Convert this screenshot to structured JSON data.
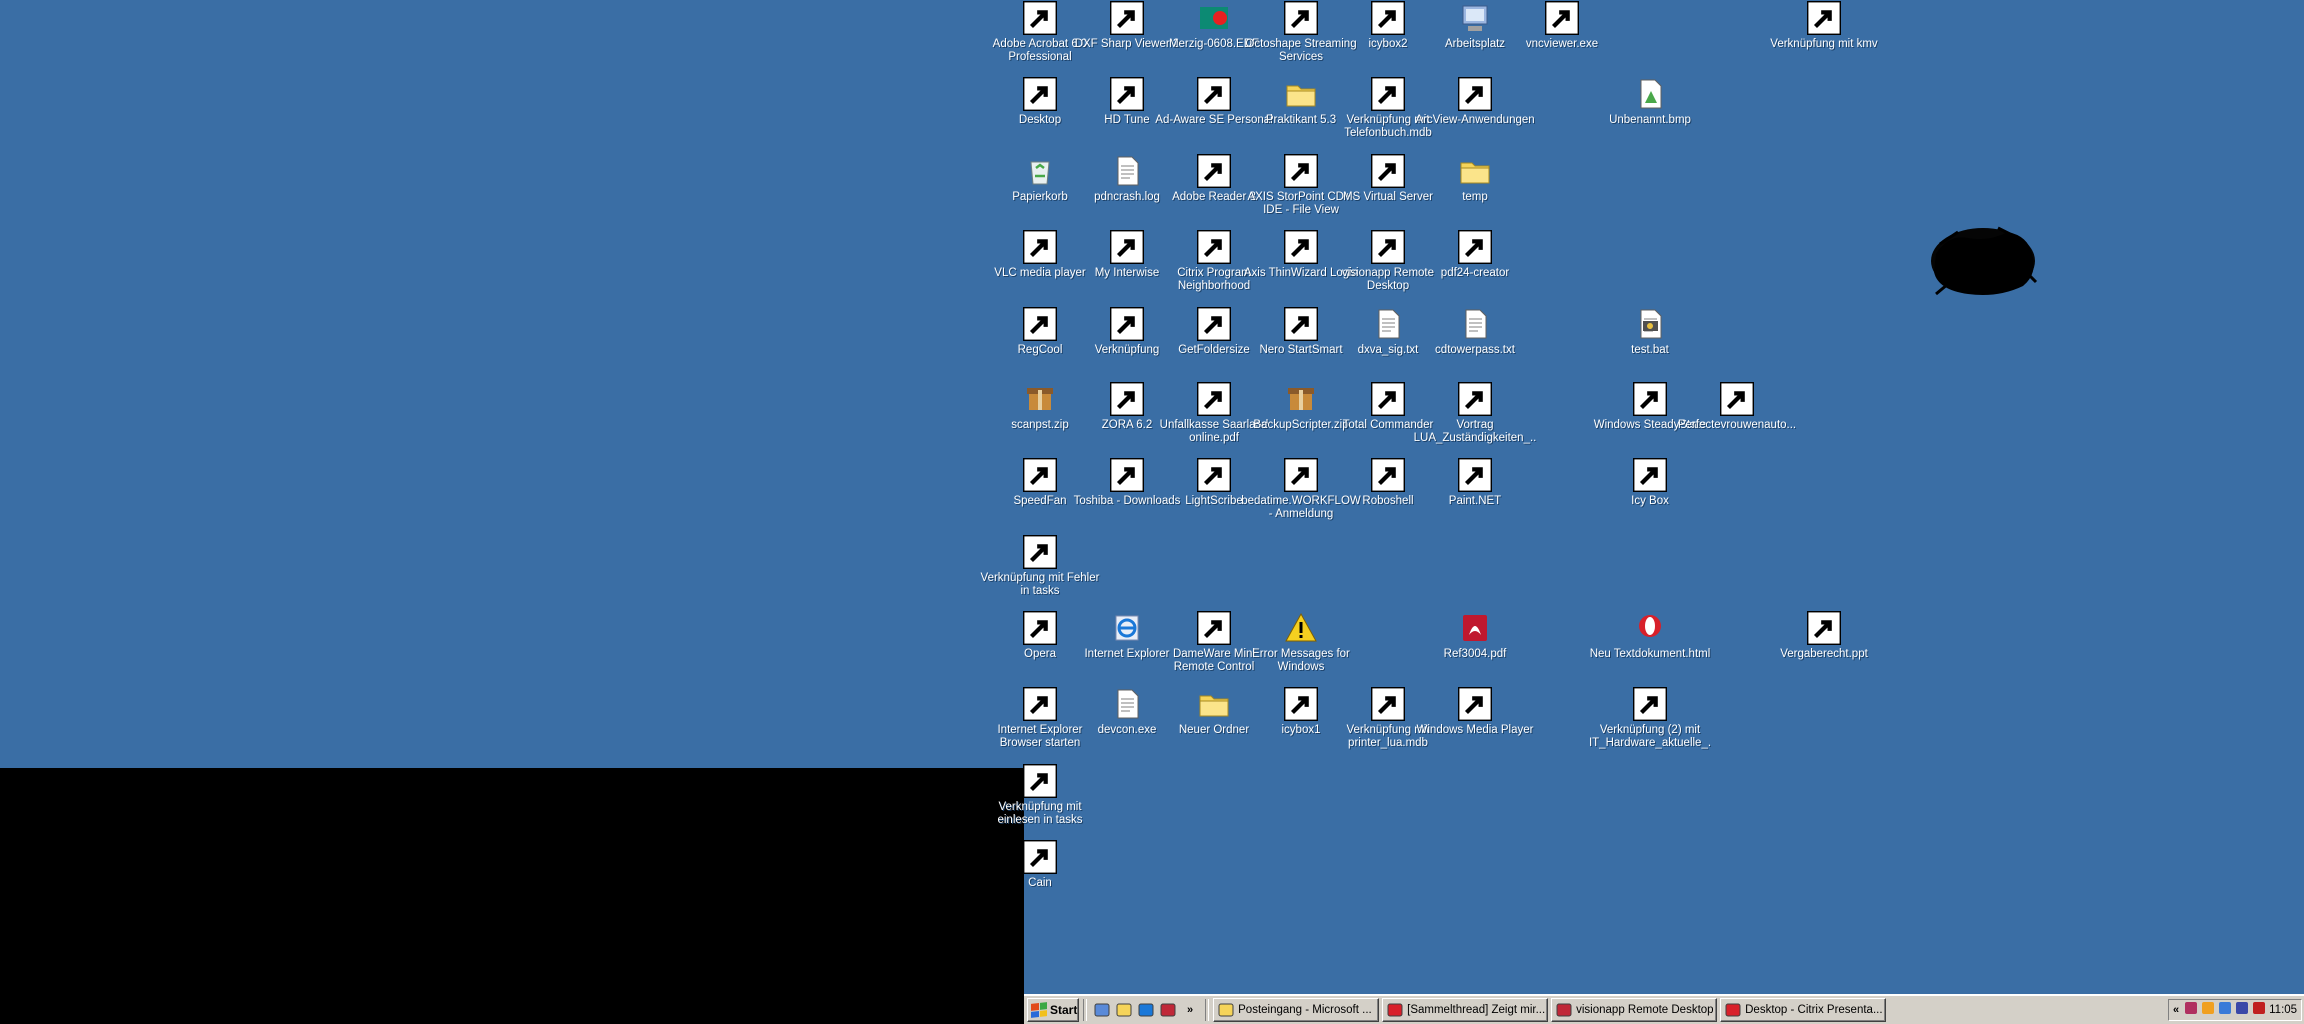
{
  "desktop": {
    "background_color": "#3a6ea5",
    "icons": [
      {
        "label": "Adobe Acrobat 6.0 Professional",
        "icon": "acrobat-icon",
        "color": "#c0182e",
        "shortcut": true
      },
      {
        "label": "DXF Sharp Viewer 2",
        "icon": "dxf-viewer-icon",
        "color": "#2a9d3a",
        "shortcut": true
      },
      {
        "label": "Merzig-0608.EDF",
        "icon": "edf-file-icon",
        "color": "#0c8a73",
        "shortcut": false
      },
      {
        "label": "Octoshape Streaming Services",
        "icon": "octoshape-icon",
        "color": "#c8c8c8",
        "shortcut": true
      },
      {
        "label": "icybox2",
        "icon": "network-drive-icon",
        "color": "#9bb6e0",
        "shortcut": true
      },
      {
        "label": "Arbeitsplatz",
        "icon": "my-computer-icon",
        "color": "#9bb6e0",
        "shortcut": false
      },
      {
        "label": "vncviewer.exe",
        "icon": "vnc-icon",
        "color": "#c0182e",
        "shortcut": true
      },
      {
        "label": "Verknüpfung mit kmv",
        "icon": "folder-shortcut-icon",
        "color": "#f5d45a",
        "shortcut": true
      },
      {
        "label": "Desktop",
        "icon": "desktop-icon",
        "color": "#3aa5d8",
        "shortcut": true
      },
      {
        "label": "HD Tune",
        "icon": "hd-tune-icon",
        "color": "#8a8a8a",
        "shortcut": true
      },
      {
        "label": "Ad-Aware SE Personal",
        "icon": "ad-aware-icon",
        "color": "#d8322a",
        "shortcut": true
      },
      {
        "label": "Praktikant 5.3",
        "icon": "folder-icon",
        "color": "#f5d45a",
        "shortcut": false
      },
      {
        "label": "Verknüpfung mit Telefonbuch.mdb",
        "icon": "mdb-shortcut-icon",
        "color": "#b04050",
        "shortcut": true
      },
      {
        "label": "ArcView-Anwendungen",
        "icon": "folder-icon",
        "color": "#f5d45a",
        "shortcut": true
      },
      {
        "label": "Unbenannt.bmp",
        "icon": "bitmap-icon",
        "color": "#4aa84a",
        "shortcut": false
      },
      {
        "label": "Papierkorb",
        "icon": "recycle-bin-icon",
        "color": "#48a848",
        "shortcut": false
      },
      {
        "label": "pdncrash.log",
        "icon": "text-file-icon",
        "color": "#ffffff",
        "shortcut": false
      },
      {
        "label": "Adobe Reader 8",
        "icon": "adobe-reader-icon",
        "color": "#c0182e",
        "shortcut": true
      },
      {
        "label": "AXIS StorPoint CD+-IDE - File View",
        "icon": "web-shortcut-icon",
        "color": "#3a7ad8",
        "shortcut": true
      },
      {
        "label": "MS Virtual Server",
        "icon": "web-shortcut-icon",
        "color": "#3a7ad8",
        "shortcut": true
      },
      {
        "label": "temp",
        "icon": "folder-icon",
        "color": "#f5d45a",
        "shortcut": false
      },
      {
        "label": "VLC media player",
        "icon": "vlc-icon",
        "color": "#f08a1a",
        "shortcut": true
      },
      {
        "label": "My Interwise",
        "icon": "info-icon",
        "color": "#e8a020",
        "shortcut": true
      },
      {
        "label": "Citrix Program Neighborhood",
        "icon": "citrix-icon",
        "color": "#d8202a",
        "shortcut": true
      },
      {
        "label": "Axis ThinWizard Login",
        "icon": "warning-shortcut-icon",
        "color": "#f5d020",
        "shortcut": true
      },
      {
        "label": "visionapp Remote Desktop",
        "icon": "rss-remote-icon",
        "color": "#c02838",
        "shortcut": true
      },
      {
        "label": "pdf24-creator",
        "icon": "pdf24-icon",
        "color": "#e8e8e8",
        "shortcut": true
      },
      {
        "label": "RegCool",
        "icon": "regcool-icon",
        "color": "#5a8ad8",
        "shortcut": true
      },
      {
        "label": "Verknüpfung",
        "icon": "folder-shortcut-icon",
        "color": "#f5d45a",
        "shortcut": true,
        "redacted": true
      },
      {
        "label": "GetFoldersize",
        "icon": "getfoldersize-icon",
        "color": "#f5d45a",
        "shortcut": true
      },
      {
        "label": "Nero StartSmart",
        "icon": "nero-icon",
        "color": "#e84020",
        "shortcut": true
      },
      {
        "label": "dxva_sig.txt",
        "icon": "text-file-icon",
        "color": "#ffffff",
        "shortcut": false
      },
      {
        "label": "cdtowerpass.txt",
        "icon": "text-file-icon",
        "color": "#ffffff",
        "shortcut": false
      },
      {
        "label": "test.bat",
        "icon": "batch-file-icon",
        "color": "#d0d0d0",
        "shortcut": false
      },
      {
        "label": "scanpst.zip",
        "icon": "zip-icon",
        "color": "#c88a3a",
        "shortcut": false
      },
      {
        "label": "ZORA 6.2",
        "icon": "zora-icon",
        "color": "#38a838",
        "shortcut": true
      },
      {
        "label": "Unfallkasse Saarland online.pdf",
        "icon": "pdf-shortcut-icon",
        "color": "#c0182e",
        "shortcut": true
      },
      {
        "label": "BackupScripter.zip",
        "icon": "zip-icon",
        "color": "#c88a3a",
        "shortcut": false
      },
      {
        "label": "Total Commander",
        "icon": "total-commander-icon",
        "color": "#3a48c8",
        "shortcut": true
      },
      {
        "label": "Vortrag LUA_Zuständigkeiten_...",
        "icon": "ppt-shortcut-icon",
        "color": "#e0e0e0",
        "shortcut": true
      },
      {
        "label": "Windows SteadyState",
        "icon": "steadystate-icon",
        "color": "#8ab0e0",
        "shortcut": true
      },
      {
        "label": "Perfectevrouwenauto...",
        "icon": "media-shortcut-icon",
        "color": "#f0f0f0",
        "shortcut": true
      },
      {
        "label": "SpeedFan",
        "icon": "speedfan-icon",
        "color": "#1a1a1a",
        "shortcut": true
      },
      {
        "label": "Toshiba - Downloads",
        "icon": "web-shortcut-icon",
        "color": "#3a7ad8",
        "shortcut": true
      },
      {
        "label": "LightScribe",
        "icon": "lightscribe-icon",
        "color": "#202020",
        "shortcut": true
      },
      {
        "label": "bedatime.WORKFLOW - Anmeldung",
        "icon": "web-shortcut-icon",
        "color": "#3a7ad8",
        "shortcut": true
      },
      {
        "label": "Roboshell",
        "icon": "roboshell-icon",
        "color": "#2a2a7a",
        "shortcut": true
      },
      {
        "label": "Paint.NET",
        "icon": "paintnet-icon",
        "color": "#e8e8f0",
        "shortcut": true
      },
      {
        "label": "Icy Box",
        "icon": "icybox-icon",
        "color": "#2a3aa8",
        "shortcut": true
      },
      {
        "label": "Verknüpfung mit Fehler in tasks",
        "icon": "tasks-shortcut-icon",
        "color": "#e0e0e0",
        "shortcut": true
      },
      {
        "label": "Opera",
        "icon": "opera-icon",
        "color": "#d8202a",
        "shortcut": true
      },
      {
        "label": "Internet Explorer",
        "icon": "ie-icon",
        "color": "#1a78d8",
        "shortcut": false
      },
      {
        "label": "DameWare Mini Remote Control",
        "icon": "dameware-icon",
        "color": "#38a838",
        "shortcut": true
      },
      {
        "label": "Error Messages for Windows",
        "icon": "warning-icon",
        "color": "#f5d020",
        "shortcut": false
      },
      {
        "label": "Ref3004.pdf",
        "icon": "pdf-icon",
        "color": "#c0182e",
        "shortcut": false
      },
      {
        "label": "Neu Textdokument.html",
        "icon": "opera-doc-icon",
        "color": "#d8202a",
        "shortcut": false
      },
      {
        "label": "Vergaberecht.ppt",
        "icon": "ppt-shortcut-icon",
        "color": "#d84a2a",
        "shortcut": true
      },
      {
        "label": "Internet Explorer Browser starten",
        "icon": "ie-icon",
        "color": "#1a78d8",
        "shortcut": true
      },
      {
        "label": "devcon.exe",
        "icon": "exe-icon",
        "color": "#e8e8e8",
        "shortcut": false
      },
      {
        "label": "Neuer Ordner",
        "icon": "folder-icon",
        "color": "#f5d45a",
        "shortcut": false
      },
      {
        "label": "icybox1",
        "icon": "network-drive-icon",
        "color": "#9bb6e0",
        "shortcut": true
      },
      {
        "label": "Verknüpfung mit printer_lua.mdb",
        "icon": "mdb-shortcut-icon",
        "color": "#b04050",
        "shortcut": true
      },
      {
        "label": "Windows Media Player",
        "icon": "wmp-icon",
        "color": "#f0a020",
        "shortcut": true
      },
      {
        "label": "Verknüpfung (2) mit IT_Hardware_aktuelle_...",
        "icon": "mdb-shortcut-icon",
        "color": "#b04050",
        "shortcut": true
      },
      {
        "label": "Verknüpfung mit einlesen in tasks",
        "icon": "script-shortcut-icon",
        "color": "#e8c040",
        "shortcut": true
      },
      {
        "label": "Cain",
        "icon": "cain-icon",
        "color": "#c02020",
        "shortcut": true
      }
    ]
  },
  "taskbar": {
    "start_label": "Start",
    "quick_launch": [
      {
        "icon": "show-desktop-icon",
        "color": "#5a8ad8"
      },
      {
        "icon": "folder-icon",
        "color": "#f5d45a"
      },
      {
        "icon": "ie-icon",
        "color": "#1a78d8"
      },
      {
        "icon": "rss-remote-icon",
        "color": "#c02838"
      }
    ],
    "chevron": "»",
    "tasks": [
      {
        "label": "Posteingang - Microsoft ...",
        "icon": "outlook-icon",
        "color": "#f5d45a"
      },
      {
        "label": "[Sammelthread] Zeigt mir...",
        "icon": "opera-icon",
        "color": "#d8202a"
      },
      {
        "label": "visionapp Remote Desktop",
        "icon": "rss-remote-icon",
        "color": "#c02838"
      },
      {
        "label": "Desktop - Citrix Presenta...",
        "icon": "citrix-icon",
        "color": "#d8202a"
      }
    ],
    "tray_chevron": "«",
    "tray_icons": [
      {
        "icon": "tray-app-icon-1",
        "color": "#b03060"
      },
      {
        "icon": "tray-app-icon-2",
        "color": "#f0a020"
      },
      {
        "icon": "tray-network-icon",
        "color": "#3a7ad8"
      },
      {
        "icon": "tray-speaker-icon",
        "color": "#3a48a8"
      },
      {
        "icon": "tray-security-icon",
        "color": "#c02020"
      }
    ],
    "clock": "11:05"
  }
}
